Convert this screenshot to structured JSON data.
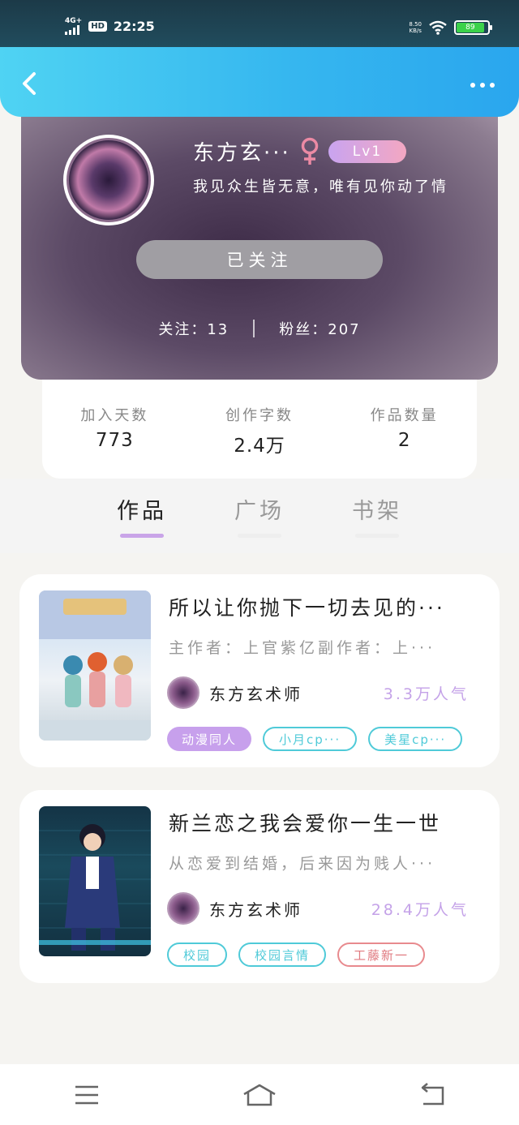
{
  "status_bar": {
    "network": "4G+",
    "hd": "HD",
    "time": "22:25",
    "speed_value": "8.50",
    "speed_unit": "KB/s",
    "battery": "89"
  },
  "profile": {
    "name": "东方玄···",
    "level": "Lv1",
    "signature": "我见众生皆无意，唯有见你动了情",
    "follow_button": "已关注",
    "following_label": "关注：13",
    "followers_label": "粉丝：207"
  },
  "stats": [
    {
      "label": "加入天数",
      "value": "773"
    },
    {
      "label": "创作字数",
      "value": "2.4万"
    },
    {
      "label": "作品数量",
      "value": "2"
    }
  ],
  "tabs": [
    {
      "label": "作品",
      "active": true
    },
    {
      "label": "广场",
      "active": false
    },
    {
      "label": "书架",
      "active": false
    }
  ],
  "works": [
    {
      "title": "所以让你抛下一切去见的···",
      "desc": "主作者：上官紫亿副作者：上···",
      "author": "东方玄术师",
      "popularity": "3.3万人气",
      "tags": [
        "动漫同人",
        "小月cp···",
        "美星cp···"
      ]
    },
    {
      "title": "新兰恋之我会爱你一生一世",
      "desc": "从恋爱到结婚，后来因为贱人···",
      "author": "东方玄术师",
      "popularity": "28.4万人气",
      "tags": [
        "校园",
        "校园言情",
        "工藤新一"
      ]
    }
  ],
  "colors": {
    "header": "#36b7ef",
    "accent_purple": "#c7a0ec",
    "tag_cyan": "#4fcad8",
    "tag_red": "#e07a80"
  },
  "icons": {
    "back": "chevron-left-icon",
    "more": "more-dots-icon",
    "gender": "female-icon",
    "nav_menu": "menu-icon",
    "nav_home": "home-icon",
    "nav_back": "return-icon"
  }
}
